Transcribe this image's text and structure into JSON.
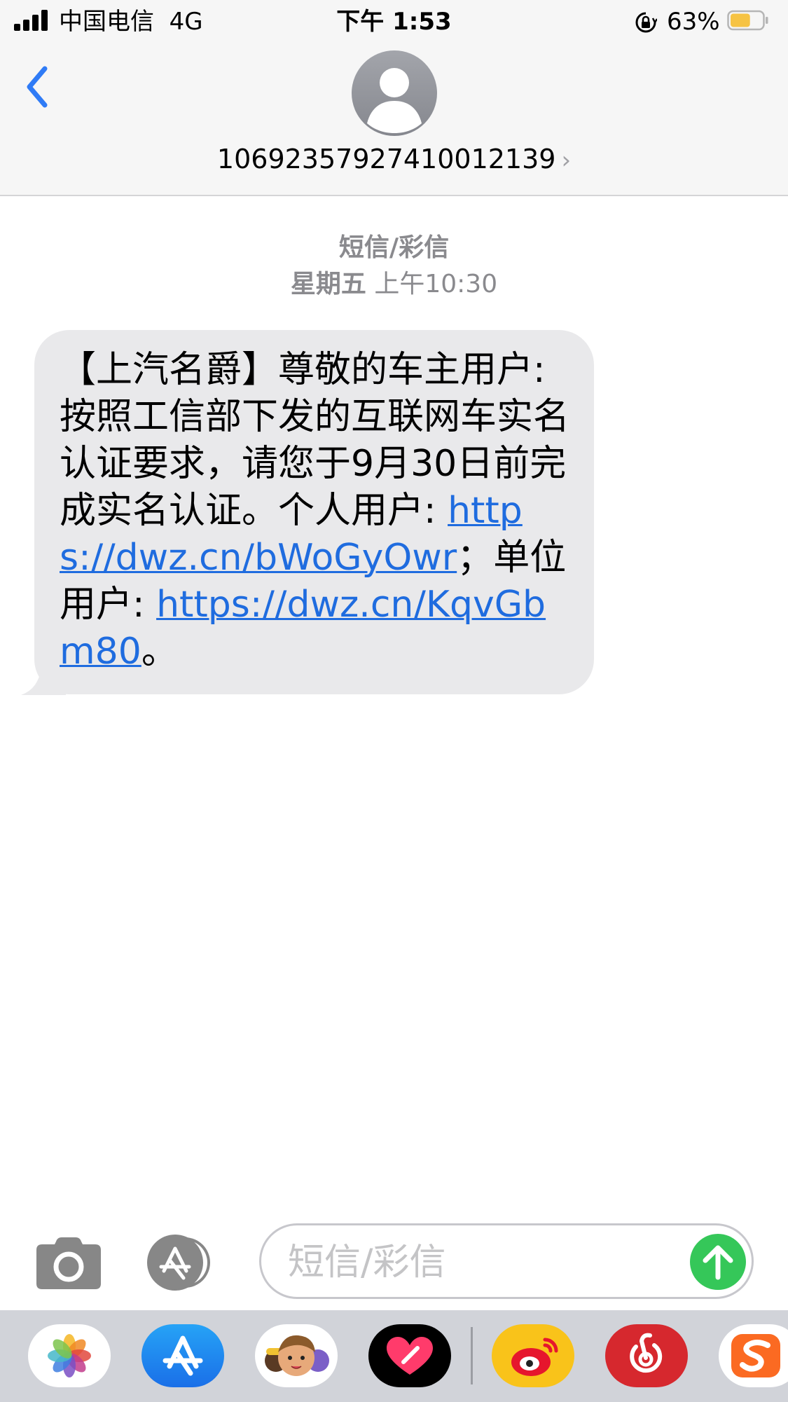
{
  "status_bar": {
    "carrier": "中国电信",
    "network": "4G",
    "time": "下午 1:53",
    "battery_percent": "63%",
    "battery_level": 0.63,
    "signal_bars": 4,
    "icons": [
      "signal-icon",
      "rotation-lock-icon",
      "battery-icon"
    ]
  },
  "header": {
    "back_icon": "chevron-left-icon",
    "avatar_icon": "person-icon",
    "contact": "106923579274100121 39",
    "contact_full": "10692357927410012139",
    "detail_chevron": "›"
  },
  "thread": {
    "message_type": "短信/彩信",
    "date_day": "星期五",
    "date_time": "上午10:30",
    "message": {
      "text_1": "【上汽名爵】尊敬的车主用户: 按照工信部下发的互联网车实名认证要求，请您于9月30日前完成实名认证。个人用户: ",
      "link_1": "https://dwz.cn/bWoGyOwr",
      "text_2": "；单位用户: ",
      "link_2": "https://dwz.cn/KqvGbm80",
      "text_3": "。"
    }
  },
  "compose": {
    "camera_icon": "camera-icon",
    "apps_icon": "app-store-icon",
    "placeholder": "短信/彩信",
    "send_icon": "arrow-up-icon"
  },
  "app_strip": [
    {
      "name": "photos-app-icon"
    },
    {
      "name": "app-store-app-icon"
    },
    {
      "name": "memoji-app-icon"
    },
    {
      "name": "digital-touch-app-icon"
    },
    {
      "name": "weibo-app-icon"
    },
    {
      "name": "netease-music-app-icon"
    },
    {
      "name": "sogou-app-icon"
    }
  ],
  "colors": {
    "link": "#1f6cdf",
    "back_arrow": "#2f7bf6",
    "bubble": "#e9e9eb",
    "send": "#35c759",
    "battery_fill": "#f6c343",
    "secondary_text": "#8a8a8e"
  }
}
